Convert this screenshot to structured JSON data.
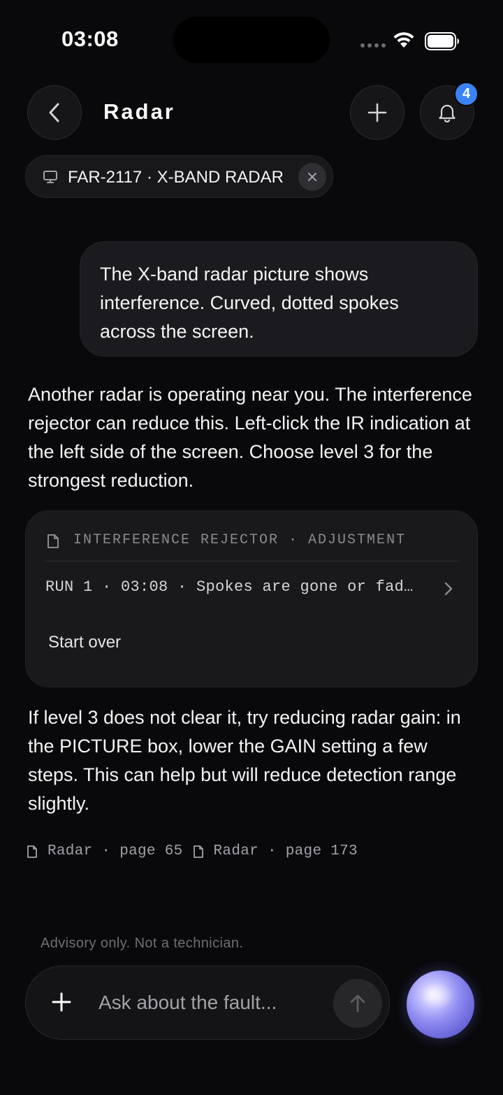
{
  "status_bar": {
    "time": "03:08"
  },
  "header": {
    "title": "Radar",
    "back_icon": "chevron-left-icon",
    "add_icon": "plus-icon",
    "notifications_icon": "bell-icon",
    "notification_count": "4"
  },
  "device_chip": {
    "icon": "monitor-icon",
    "label": "FAR-2117 · X-BAND RADAR",
    "close_icon": "close-icon"
  },
  "conversation": {
    "user_message": "The X-band radar picture shows interference. Curved, dotted spokes across the screen.",
    "reply_1": "Another radar is operating near you. The interference rejector can reduce this. Left-click the IR indication at the left side of the screen. Choose level 3 for the strongest reduction.",
    "procedure_card": {
      "icon": "document-icon",
      "heading": "INTERFERENCE REJECTOR · ADJUSTMENT",
      "run_text": "RUN 1 · 03:08 · Spokes are gone or fad…",
      "start_over": "Start over"
    },
    "reply_2": "If level 3 does not clear it, try reducing radar gain: in the PICTURE box, lower the GAIN setting a few steps. This can help but will reduce detection range slightly.",
    "sources": [
      {
        "icon": "document-icon",
        "label": "Radar · page 65"
      },
      {
        "icon": "document-icon",
        "label": "Radar · page 173"
      }
    ]
  },
  "footer": {
    "advisory": "Advisory only. Not a technician.",
    "input_placeholder": "Ask about the fault...",
    "input_value": "",
    "attach_icon": "plus-icon",
    "send_icon": "arrow-up-icon",
    "assistant_orb": "assistant-orb-icon"
  },
  "colors": {
    "background": "#09090b",
    "surface": "#19191c",
    "badge": "#3b82f6",
    "orb": "#8f8cf2"
  }
}
